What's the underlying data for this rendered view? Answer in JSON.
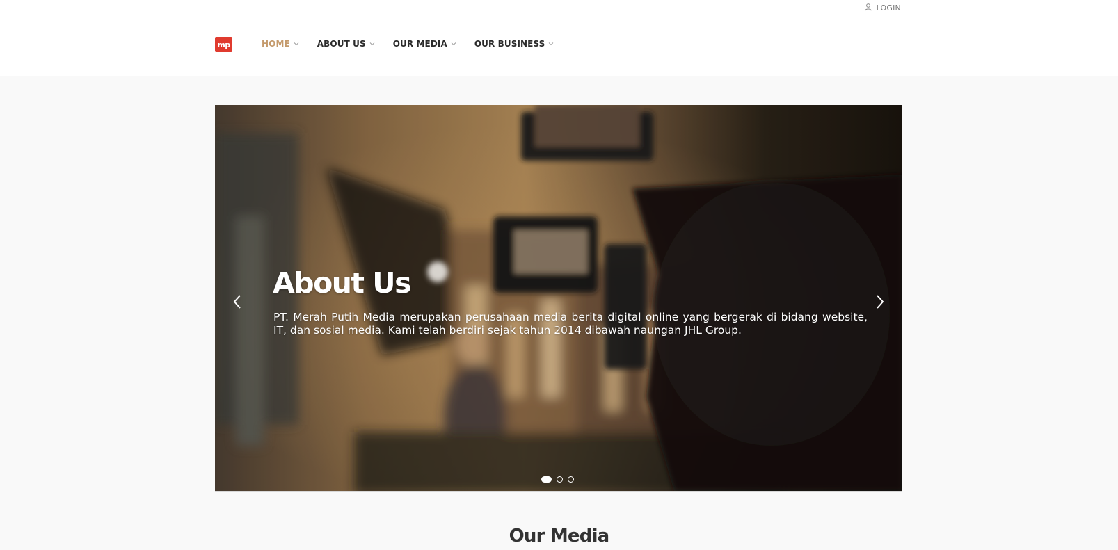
{
  "topbar": {
    "login_label": "LOGIN",
    "login_icon": "user-icon"
  },
  "logo": {
    "text": "mp",
    "color": "#e03b2f"
  },
  "nav": {
    "active_color": "#c49a6c",
    "items": [
      {
        "label": "HOME",
        "active": true
      },
      {
        "label": "ABOUT US",
        "active": false
      },
      {
        "label": "OUR MEDIA",
        "active": false
      },
      {
        "label": "OUR BUSINESS",
        "active": false
      }
    ]
  },
  "hero": {
    "title": "About Us",
    "text": "PT. Merah Putih Media merupakan perusahaan media berita digital online yang bergerak di bidang website, IT, dan sosial media. Kami telah berdiri sejak tahun 2014 dibawah naungan JHL Group.",
    "prev_icon": "chevron-left-icon",
    "next_icon": "chevron-right-icon",
    "slide_count": 3,
    "active_slide": 1
  },
  "section": {
    "title": "Our Media"
  }
}
